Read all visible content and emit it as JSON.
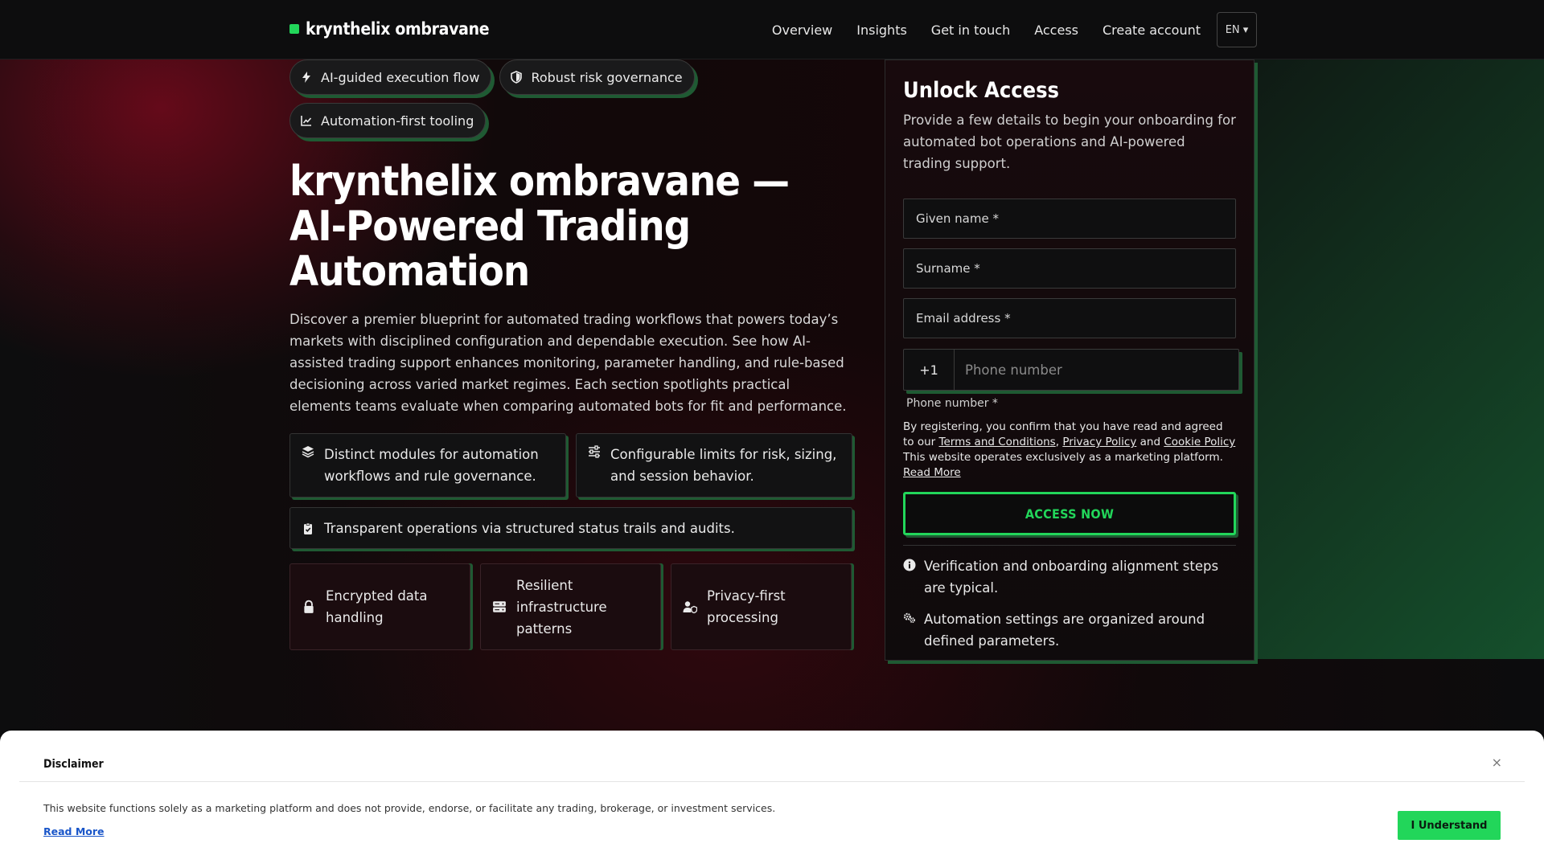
{
  "brand": {
    "name": "krynthelix ombravane",
    "accent": "#22d65a"
  },
  "nav": {
    "items": [
      "Overview",
      "Insights",
      "Get in touch",
      "Access",
      "Create account"
    ],
    "lang": "EN ▾"
  },
  "pills": [
    {
      "label": "AI-guided execution flow",
      "icon": "bolt-icon"
    },
    {
      "label": "Robust risk governance",
      "icon": "shield-icon"
    },
    {
      "label": "Automation-first tooling",
      "icon": "chart-line-icon"
    }
  ],
  "hero": {
    "title_line1": "krynthelix ombravane —",
    "title_line2": "AI-Powered Trading Automation",
    "lead": "Discover a premier blueprint for automated trading workflows that powers today’s markets with disciplined configuration and dependable execution. See how AI-assisted trading support enhances monitoring, parameter handling, and rule-based decisioning across varied market regimes. Each section spotlights practical elements teams evaluate when comparing automated bots for fit and performance."
  },
  "features": [
    {
      "text": "Distinct modules for automation workflows and rule governance.",
      "icon": "layers-icon"
    },
    {
      "text": "Configurable limits for risk, sizing, and session behavior.",
      "icon": "sliders-icon"
    },
    {
      "text": "Transparent operations via structured status trails and audits.",
      "icon": "clipboard-check-icon"
    }
  ],
  "security": [
    {
      "text": "Encrypted data handling",
      "icon": "lock-icon"
    },
    {
      "text": "Resilient infrastructure patterns",
      "icon": "server-icon"
    },
    {
      "text": "Privacy-first processing",
      "icon": "user-shield-icon"
    }
  ],
  "form": {
    "title": "Unlock Access",
    "subtitle": "Provide a few details to begin your onboarding for automated bot operations and AI-powered trading support.",
    "given_name": "Given name *",
    "surname": "Surname *",
    "email": "Email address *",
    "country_code": "+1",
    "phone_placeholder": "Phone number",
    "phone_label": "Phone number *",
    "consent_prefix": "By registering, you confirm that you have read and agreed to our",
    "terms": "Terms and Conditions",
    "privacy": "Privacy Policy",
    "and": "and",
    "cookie": "Cookie Policy",
    "consent_suffix": "This website operates exclusively as a marketing platform.",
    "read_more": "Read More",
    "cta": "ACCESS NOW",
    "notes": [
      {
        "text": "Verification and onboarding alignment steps are typical.",
        "icon": "info-icon"
      },
      {
        "text": "Automation settings are organized around defined parameters.",
        "icon": "gears-icon"
      }
    ]
  },
  "disclaimer": {
    "title": "Disclaimer",
    "close": "×",
    "text": "This website functions solely as a marketing platform and does not provide, endorse, or facilitate any trading, brokerage, or investment services.",
    "read_more": "Read More",
    "button": "I Understand"
  }
}
